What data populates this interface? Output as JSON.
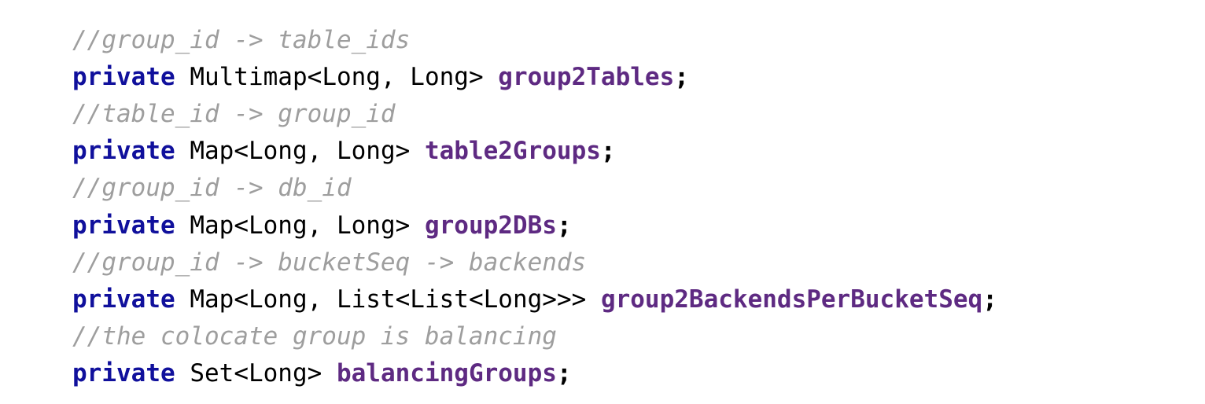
{
  "code": {
    "l1_comment": "//group_id -> table_ids",
    "l2_kw": "private",
    "l2_type": " Multimap",
    "l2_lt1": "<",
    "l2_p1": "Long",
    "l2_comma": ", ",
    "l2_p2": "Long",
    "l2_gt1": "> ",
    "l2_name": "group2Tables",
    "l2_sc": ";",
    "l3_comment": "//table_id -> group_id",
    "l4_kw": "private",
    "l4_type": " Map",
    "l4_lt1": "<",
    "l4_p1": "Long",
    "l4_comma": ", ",
    "l4_p2": "Long",
    "l4_gt1": "> ",
    "l4_name": "table2Groups",
    "l4_sc": ";",
    "l5_comment": "//group_id -> db_id",
    "l6_kw": "private",
    "l6_type": " Map",
    "l6_lt1": "<",
    "l6_p1": "Long",
    "l6_comma": ", ",
    "l6_p2": "Long",
    "l6_gt1": "> ",
    "l6_name": "group2DBs",
    "l6_sc": ";",
    "l7_comment": "//group_id -> bucketSeq -> backends",
    "l8_kw": "private",
    "l8_type": " Map",
    "l8_lt1": "<",
    "l8_p1": "Long",
    "l8_comma": ", ",
    "l8_p2": "List",
    "l8_lt2": "<",
    "l8_p3": "List",
    "l8_lt3": "<",
    "l8_p4": "Long",
    "l8_gt3": ">>> ",
    "l8_name": "group2BackendsPerBucketSeq",
    "l8_sc": ";",
    "l9_comment": "//the colocate group is balancing",
    "l10_kw": "private",
    "l10_type": " Set",
    "l10_lt1": "<",
    "l10_p1": "Long",
    "l10_gt1": "> ",
    "l10_name": "balancingGroups",
    "l10_sc": ";"
  }
}
